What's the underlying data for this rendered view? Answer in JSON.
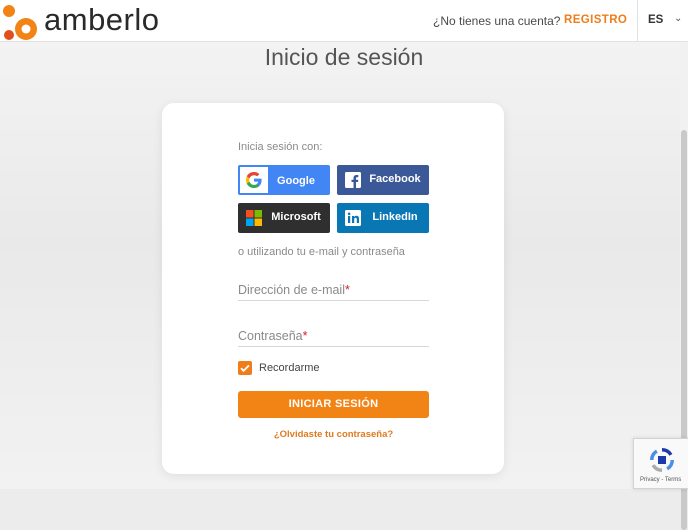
{
  "header": {
    "logo_text": "amberlo",
    "no_account": "¿No tienes una cuenta?",
    "register": "REGISTRO",
    "language": "ES",
    "language_caret": "⌄"
  },
  "page": {
    "title": "Inicio de sesión"
  },
  "login": {
    "login_with": "Inicia sesión con:",
    "social": {
      "google": "Google",
      "facebook": "Facebook",
      "microsoft": "Microsoft",
      "linkedin": "LinkedIn"
    },
    "or_email": "o utilizando tu e-mail y contraseña",
    "email_label": "Dirección de e-mail",
    "password_label": "Contraseña",
    "required_mark": "*",
    "remember": "Recordarme",
    "remember_checked": true,
    "submit": "INICIAR SESIÓN",
    "forgot": "¿Olvidaste tu contraseña?"
  },
  "recaptcha": {
    "text": "Privacy - Terms"
  },
  "colors": {
    "accent": "#f28416",
    "google": "#4285f4",
    "facebook": "#3b5998",
    "microsoft": "#2f2f2f",
    "linkedin": "#0a77b5"
  },
  "icons": {
    "logo": "amberlo-logo-icon",
    "google": "google-icon",
    "facebook": "facebook-icon",
    "microsoft": "microsoft-icon",
    "linkedin": "linkedin-icon",
    "check": "check-icon",
    "recaptcha": "recaptcha-icon"
  }
}
